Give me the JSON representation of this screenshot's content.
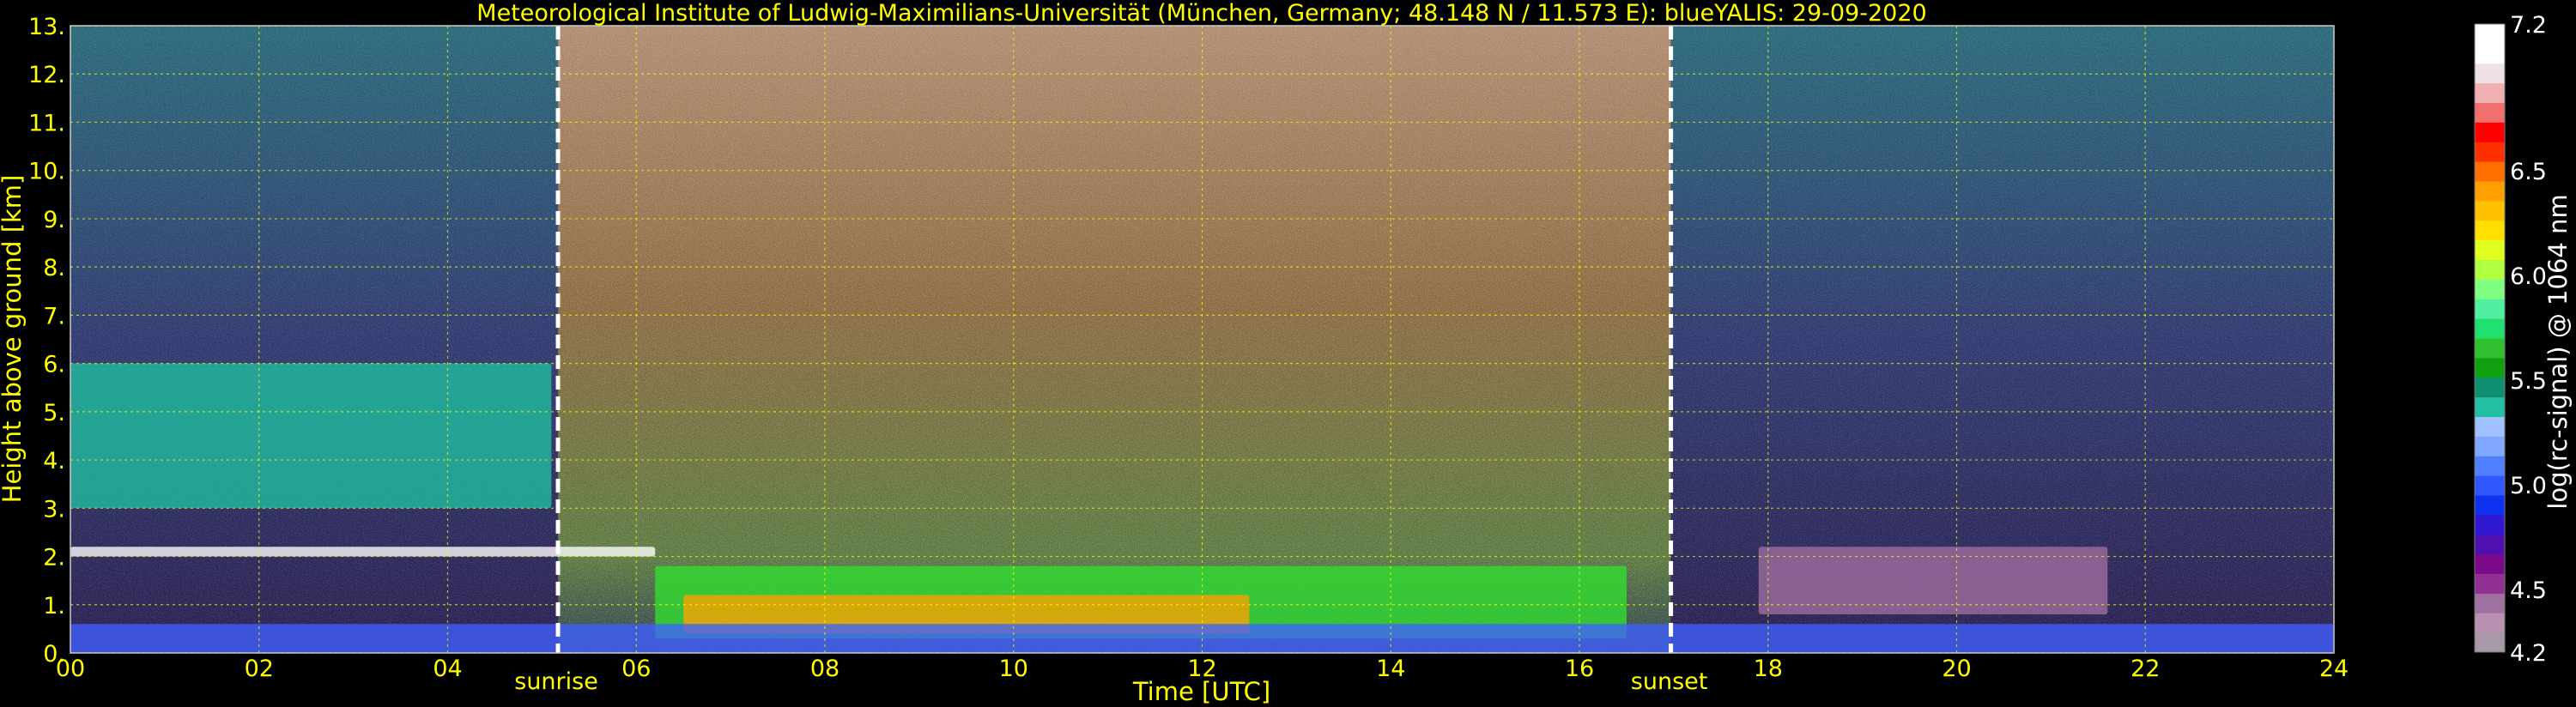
{
  "chart_data": {
    "type": "heatmap",
    "title": "Meteorological Institute of Ludwig-Maximilians-Universität (München, Germany; 48.148 N / 11.573 E):     blueYALIS: 29-09-2020",
    "xlabel": "Time [UTC]",
    "ylabel": "Height above ground [km]",
    "xlim": [
      0,
      24
    ],
    "ylim": [
      0,
      13
    ],
    "x_ticks": [
      {
        "value": 0,
        "label": "00"
      },
      {
        "value": 2,
        "label": "02"
      },
      {
        "value": 4,
        "label": "04"
      },
      {
        "value": 6,
        "label": "06"
      },
      {
        "value": 8,
        "label": "08"
      },
      {
        "value": 10,
        "label": "10"
      },
      {
        "value": 12,
        "label": "12"
      },
      {
        "value": 14,
        "label": "14"
      },
      {
        "value": 16,
        "label": "16"
      },
      {
        "value": 18,
        "label": "18"
      },
      {
        "value": 20,
        "label": "20"
      },
      {
        "value": 22,
        "label": "22"
      },
      {
        "value": 24,
        "label": "24"
      }
    ],
    "y_ticks": [
      {
        "value": 0,
        "label": "0."
      },
      {
        "value": 1,
        "label": "1."
      },
      {
        "value": 2,
        "label": "2."
      },
      {
        "value": 3,
        "label": "3."
      },
      {
        "value": 4,
        "label": "4."
      },
      {
        "value": 5,
        "label": "5."
      },
      {
        "value": 6,
        "label": "6."
      },
      {
        "value": 7,
        "label": "7."
      },
      {
        "value": 8,
        "label": "8."
      },
      {
        "value": 9,
        "label": "9."
      },
      {
        "value": 10,
        "label": "10."
      },
      {
        "value": 11,
        "label": "11."
      },
      {
        "value": 12,
        "label": "12."
      },
      {
        "value": 13,
        "label": "13."
      }
    ],
    "grid": true,
    "grid_color": "#ffff00",
    "events": [
      {
        "label": "sunrise",
        "time": 5.17
      },
      {
        "label": "sunset",
        "time": 16.97
      }
    ],
    "colorbar": {
      "label": "log(rc-signal) @ 1064 nm",
      "range": [
        4.2,
        7.2
      ],
      "ticks": [
        {
          "value": 4.2,
          "label": "4.2"
        },
        {
          "value": 4.5,
          "label": "4.5"
        },
        {
          "value": 5.0,
          "label": "5.0"
        },
        {
          "value": 5.5,
          "label": "5.5"
        },
        {
          "value": 6.0,
          "label": "6.0"
        },
        {
          "value": 6.5,
          "label": "6.5"
        },
        {
          "value": 7.2,
          "label": "7.2"
        }
      ],
      "colors": [
        "#a898a8",
        "#b890b0",
        "#a070a0",
        "#903090",
        "#7a0a8a",
        "#5010b0",
        "#3018d0",
        "#1030f0",
        "#3058ff",
        "#5080ff",
        "#80a8ff",
        "#a0c0ff",
        "#20c0a0",
        "#109070",
        "#10a010",
        "#30c030",
        "#20e070",
        "#50f0a0",
        "#80ff80",
        "#b0ff40",
        "#e0ff20",
        "#ffe000",
        "#ffc000",
        "#ffa000",
        "#ff7000",
        "#ff3000",
        "#ff0000",
        "#f07070",
        "#f0b0b0",
        "#f0e0e8",
        "#ffffff",
        "#ffffff"
      ]
    },
    "background_regions": [
      {
        "name": "night-early",
        "x": [
          0,
          5.17
        ],
        "color": "#28305a"
      },
      {
        "name": "day",
        "x": [
          5.17,
          16.97
        ],
        "color": "#6a6040"
      },
      {
        "name": "night-late",
        "x": [
          16.97,
          24
        ],
        "color": "#2a3360"
      }
    ],
    "features": [
      {
        "name": "residual-layer-top",
        "x": [
          0,
          6.2
        ],
        "y": [
          2.0,
          2.2
        ],
        "color": "#ffffff"
      },
      {
        "name": "boundary-layer-aerosol",
        "x": [
          6.2,
          16.5
        ],
        "y": [
          0.3,
          1.8
        ],
        "color": "#30e030"
      },
      {
        "name": "mixed-layer-core",
        "x": [
          6.5,
          12.5
        ],
        "y": [
          0.4,
          1.2
        ],
        "color": "#ffa000"
      },
      {
        "name": "surface-layer",
        "x": [
          0,
          24
        ],
        "y": [
          0,
          0.6
        ],
        "color": "#4060ff"
      },
      {
        "name": "mid-level-cloud",
        "x": [
          0,
          5.1
        ],
        "y": [
          3.0,
          6.0
        ],
        "color": "#20c0a0"
      },
      {
        "name": "late-cloud-layer",
        "x": [
          17.9,
          21.6
        ],
        "y": [
          0.8,
          2.2
        ],
        "color": "#a070a0"
      }
    ]
  }
}
